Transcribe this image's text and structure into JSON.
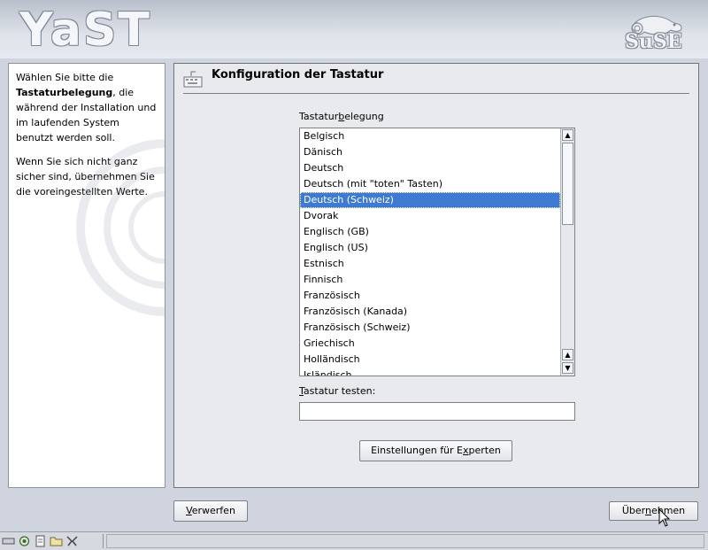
{
  "header": {
    "logo": "YaST",
    "brand": "SuSE"
  },
  "help": {
    "para1_pre": "Wählen Sie bitte die ",
    "para1_bold": "Tastaturbelegung",
    "para1_post": ", die während der Installation und im laufenden System benutzt werden soll.",
    "para2": "Wenn Sie sich nicht ganz sicher sind, übernehmen Sie die voreingestellten Werte."
  },
  "main": {
    "title": "Konfiguration der Tastatur",
    "layout_label_pre": "Tastatur",
    "layout_label_u": "b",
    "layout_label_post": "elegung",
    "layouts": [
      "Belgisch",
      "Dänisch",
      "Deutsch",
      "Deutsch (mit \"toten\" Tasten)",
      "Deutsch (Schweiz)",
      "Dvorak",
      "Englisch (GB)",
      "Englisch (US)",
      "Estnisch",
      "Finnisch",
      "Französisch",
      "Französisch (Kanada)",
      "Französisch (Schweiz)",
      "Griechisch",
      "Holländisch",
      "Isländisch"
    ],
    "selected_index": 4,
    "test_label_u": "T",
    "test_label_post": "astatur testen:",
    "test_value": "",
    "expert_pre": "Einstellungen für E",
    "expert_u": "x",
    "expert_post": "perten"
  },
  "buttons": {
    "discard_u": "V",
    "discard_post": "erwerfen",
    "accept_pre": "Über",
    "accept_u": "n",
    "accept_post": "ehmen"
  },
  "colors": {
    "selection": "#3e7ad1",
    "background": "#cfd4df"
  }
}
